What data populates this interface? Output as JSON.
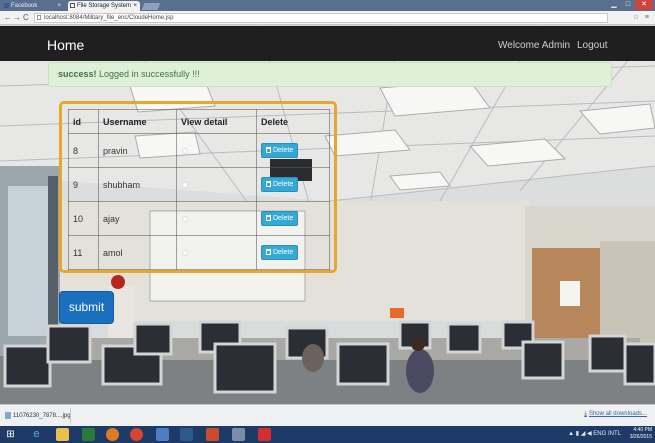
{
  "browser": {
    "tabs": [
      {
        "label": "Facebook",
        "active": false
      },
      {
        "label": "File Storage System",
        "active": true
      }
    ],
    "tab_close": "×",
    "url": "localhost:8084/Military_file_enc/CloudeHome.jsp",
    "window_controls": {
      "minimize": "▁",
      "maximize": "□",
      "close": "✕"
    }
  },
  "navbar": {
    "brand": "Home",
    "welcome": "Welcome Admin",
    "logout": "Logout"
  },
  "alert": {
    "strong": "success!",
    "message": " Logged in successfully !!!"
  },
  "table": {
    "headers": [
      "id",
      "Username",
      "View detail",
      "Delete"
    ],
    "delete_label": "Delete",
    "rows": [
      {
        "id": "8",
        "username": "pravin"
      },
      {
        "id": "9",
        "username": "shubham"
      },
      {
        "id": "10",
        "username": "ajay"
      },
      {
        "id": "11",
        "username": "amol"
      }
    ]
  },
  "submit_label": "submit",
  "downloads": {
    "file_name": "11076230_7878....jpg",
    "show_all": "Show all downloads..."
  },
  "taskbar": {
    "tray_lang": "ENG",
    "tray_region": "INTL",
    "time": "4:40 PM",
    "date": "3/26/2015"
  },
  "colors": {
    "accent_panel_border": "#e5a82c",
    "delete_button": "#35a9d6",
    "submit_button": "#1a6fbf",
    "alert_bg": "#dff0d8",
    "navbar_bg": "#141414"
  }
}
